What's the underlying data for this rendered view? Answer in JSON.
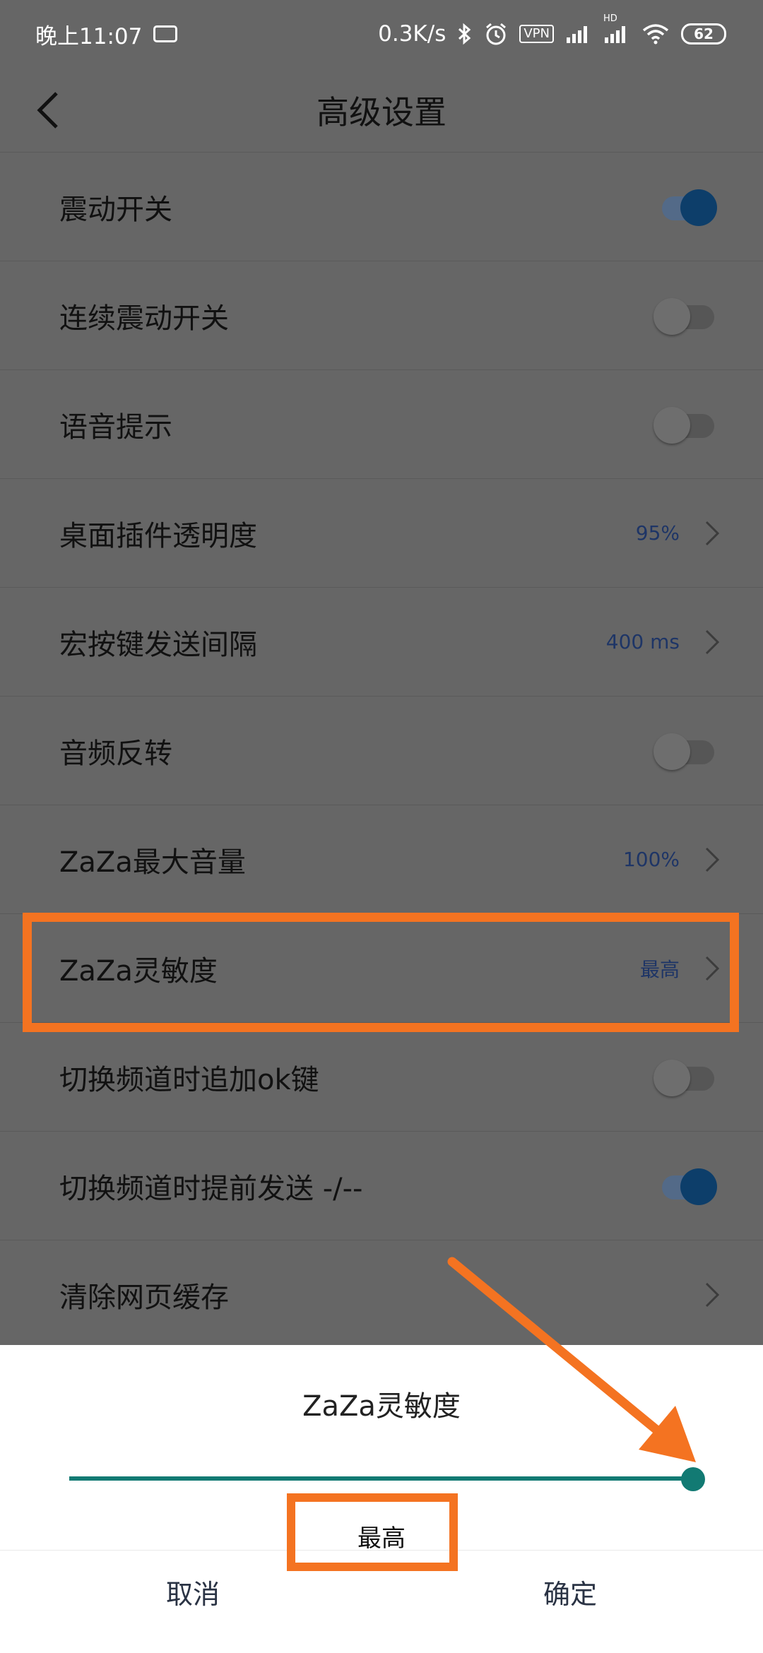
{
  "status_bar": {
    "time": "晚上11:07",
    "network_speed": "0.3K/s",
    "vpn": "VPN",
    "hd": "HD",
    "battery": "62"
  },
  "header": {
    "title": "高级设置"
  },
  "settings": [
    {
      "label": "震动开关",
      "type": "toggle",
      "on": true
    },
    {
      "label": "连续震动开关",
      "type": "toggle",
      "on": false
    },
    {
      "label": "语音提示",
      "type": "toggle",
      "on": false
    },
    {
      "label": "桌面插件透明度",
      "type": "value",
      "value": "95%"
    },
    {
      "label": "宏按键发送间隔",
      "type": "value",
      "value": "400 ms"
    },
    {
      "label": "音频反转",
      "type": "toggle",
      "on": false
    },
    {
      "label": "ZaZa最大音量",
      "type": "value",
      "value": "100%"
    },
    {
      "label": "ZaZa灵敏度",
      "type": "value",
      "value": "最高"
    },
    {
      "label": "切换频道时追加ok键",
      "type": "toggle",
      "on": false
    },
    {
      "label": "切换频道时提前发送 -/--",
      "type": "toggle",
      "on": true
    },
    {
      "label": "清除网页缓存",
      "type": "link"
    }
  ],
  "sheet": {
    "title": "ZaZa灵敏度",
    "slider_fraction": 1.0,
    "value_label": "最高",
    "cancel": "取消",
    "confirm": "确定"
  },
  "colors": {
    "accent": "#127a73",
    "annotation": "#f47321",
    "value_text": "#1e3566",
    "toggle_on": "#0d3e6a"
  }
}
